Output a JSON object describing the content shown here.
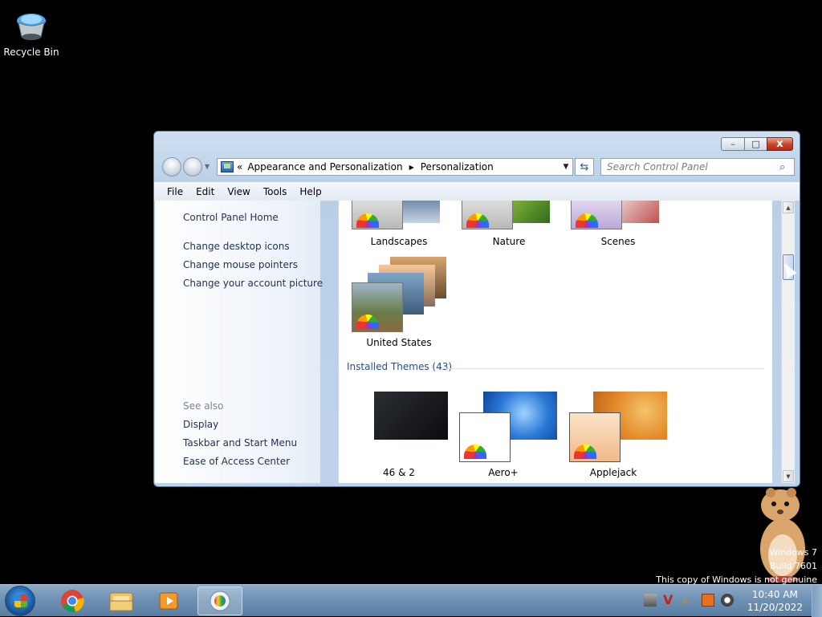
{
  "desktop": {
    "icons": [
      {
        "label": "Recycle Bin"
      }
    ],
    "watermark": {
      "line1": "Windows 7",
      "line2": "Build 7601",
      "line3": "This copy of Windows is not genuine"
    }
  },
  "window": {
    "caption_buttons": {
      "minimize": "–",
      "maximize": "□",
      "close": "x"
    },
    "address": {
      "prefix": "«",
      "segments": [
        "Appearance and Personalization",
        "Personalization"
      ]
    },
    "search": {
      "placeholder": "Search Control Panel"
    },
    "menu": [
      "File",
      "Edit",
      "View",
      "Tools",
      "Help"
    ],
    "left_pane": {
      "home": "Control Panel Home",
      "tasks": [
        "Change desktop icons",
        "Change mouse pointers",
        "Change your account picture"
      ],
      "see_also_title": "See also",
      "see_also": [
        "Display",
        "Taskbar and Start Menu",
        "Ease of Access Center"
      ]
    },
    "content": {
      "aero_themes": [
        "Landscapes",
        "Nature",
        "Scenes",
        "United States"
      ],
      "installed_title": "Installed Themes (43)",
      "installed_themes": [
        "46 & 2",
        "Aero+",
        "Applejack"
      ]
    }
  },
  "taskbar": {
    "apps": [
      "chrome-icon",
      "explorer-icon",
      "media-player-icon",
      "personalization-icon"
    ],
    "clock": {
      "time": "10:40 AM",
      "date": "11/20/2022"
    }
  }
}
